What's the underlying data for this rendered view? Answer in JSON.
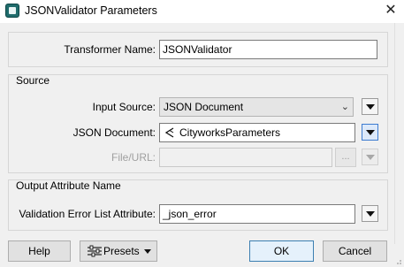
{
  "window": {
    "title": "JSONValidator Parameters",
    "close_glyph": "✕"
  },
  "transformer": {
    "label": "Transformer Name:",
    "value": "JSONValidator"
  },
  "source": {
    "group_label": "Source",
    "input_source_label": "Input Source:",
    "input_source_value": "JSON Document",
    "json_document_label": "JSON Document:",
    "json_document_value": "CityworksParameters",
    "file_url_label": "File/URL:",
    "file_url_value": "",
    "browse_label": "..."
  },
  "output": {
    "group_label": "Output Attribute Name",
    "error_list_label": "Validation Error List Attribute:",
    "error_list_value": "_json_error"
  },
  "buttons": {
    "help": "Help",
    "presets": "Presets",
    "ok": "OK",
    "cancel": "Cancel"
  },
  "icons": {
    "app": "fme-transformer-icon",
    "param": "user-parameter-icon",
    "presets": "presets-sliders-icon"
  },
  "colors": {
    "active_button_border": "#3d7bd0",
    "ok_button_border": "#3c7fb1",
    "disabled_text": "#a0a0a0"
  }
}
